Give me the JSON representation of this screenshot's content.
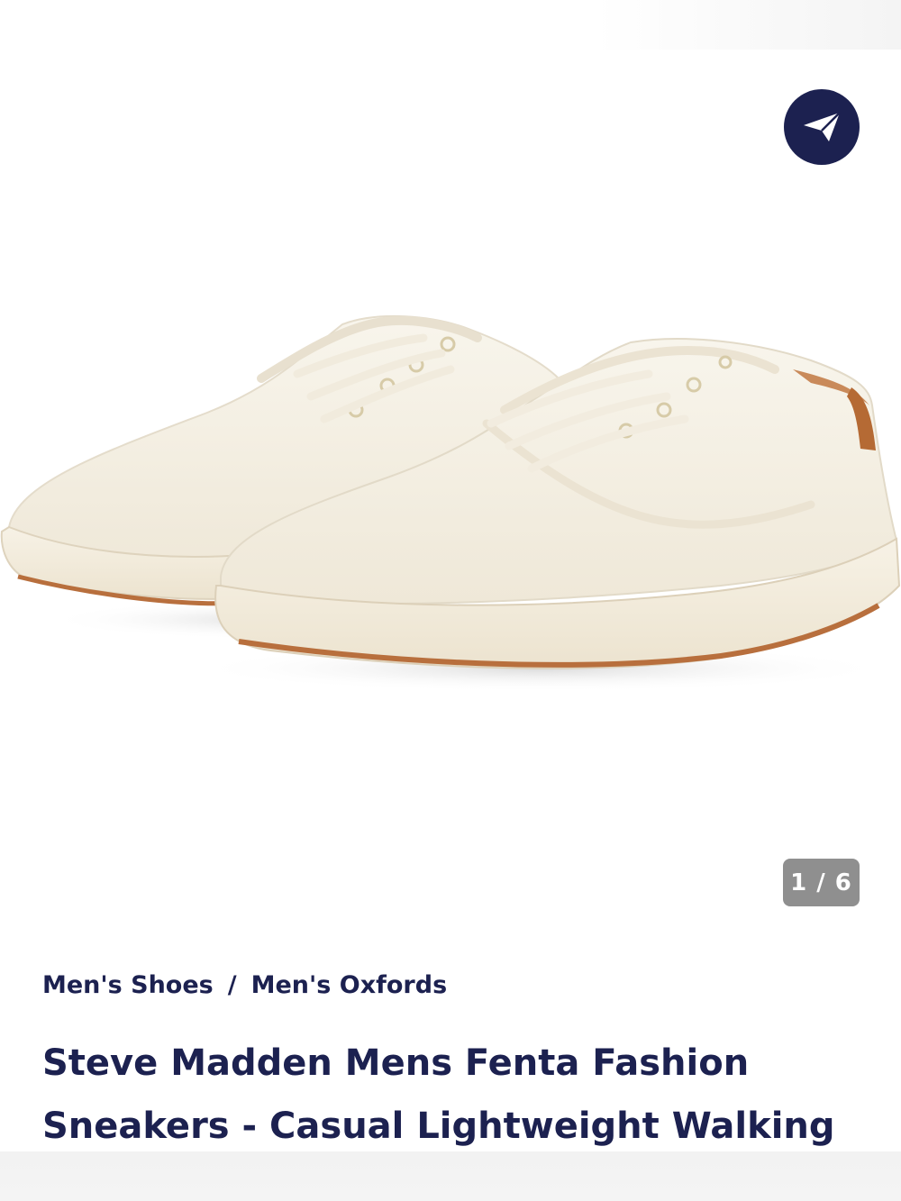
{
  "gallery": {
    "counter": "1 / 6",
    "share_icon": "paper-plane-icon",
    "colors": {
      "brand": "#1c2150",
      "counter_bg": "#8f8f8f",
      "canvas": "#f8f3e8",
      "sole_trim": "#b86f3d"
    }
  },
  "breadcrumb": {
    "items": [
      "Men's Shoes",
      "Men's Oxfords"
    ],
    "separator": "/"
  },
  "product": {
    "title": "Steve Madden Mens Fenta Fashion Sneakers - Casual Lightweight Walking"
  }
}
